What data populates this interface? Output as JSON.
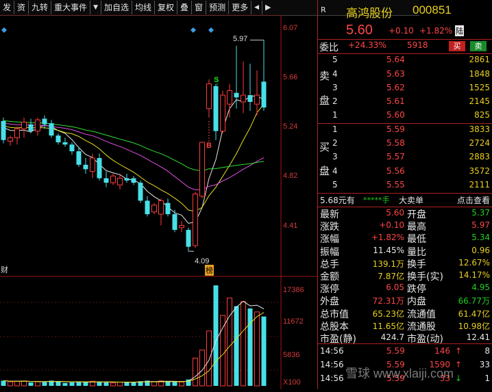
{
  "toolbar": {
    "items": [
      "发",
      "资",
      "九转",
      "重大事件",
      "▼",
      "加自选",
      "均线",
      "复权",
      "叠",
      "窗",
      "预测",
      "更多",
      "◀",
      "▶"
    ]
  },
  "chart": {
    "price_axis": [
      "6.07",
      "5.66",
      "5.24",
      "4.82",
      "4.41"
    ],
    "volume_axis": [
      "17386",
      "11672",
      "5836",
      "X100"
    ],
    "high_label": "5.97",
    "low_label": "4.09",
    "mark_s": "S",
    "mark_b": "B",
    "left_tag": "财",
    "bottom_tag": "榜"
  },
  "chart_data": {
    "type": "candlestick",
    "ohlc": [
      [
        5.25,
        5.28,
        5.05,
        5.08
      ],
      [
        5.07,
        5.12,
        5.03,
        5.1
      ],
      [
        5.1,
        5.2,
        5.04,
        5.18
      ],
      [
        5.18,
        5.28,
        5.1,
        5.24
      ],
      [
        5.22,
        5.27,
        5.14,
        5.16
      ],
      [
        5.16,
        5.28,
        5.12,
        5.26
      ],
      [
        5.27,
        5.3,
        5.18,
        5.22
      ],
      [
        5.23,
        5.26,
        5.1,
        5.12
      ],
      [
        5.12,
        5.14,
        5.04,
        5.06
      ],
      [
        5.06,
        5.1,
        5.02,
        5.04
      ],
      [
        5.04,
        5.06,
        4.95,
        4.98
      ],
      [
        4.98,
        5.02,
        4.84,
        4.86
      ],
      [
        4.86,
        4.92,
        4.78,
        4.82
      ],
      [
        4.8,
        4.96,
        4.74,
        4.92
      ],
      [
        4.92,
        4.96,
        4.72,
        4.74
      ],
      [
        4.74,
        4.8,
        4.66,
        4.7
      ],
      [
        4.7,
        4.78,
        4.68,
        4.76
      ],
      [
        4.68,
        4.78,
        4.64,
        4.74
      ],
      [
        4.74,
        4.78,
        4.7,
        4.72
      ],
      [
        4.74,
        4.76,
        4.68,
        4.7
      ],
      [
        4.7,
        4.72,
        4.52,
        4.54
      ],
      [
        4.54,
        4.58,
        4.4,
        4.42
      ],
      [
        4.44,
        4.52,
        4.42,
        4.5
      ],
      [
        4.42,
        4.56,
        4.32,
        4.54
      ],
      [
        4.52,
        4.56,
        4.4,
        4.42
      ],
      [
        4.42,
        4.46,
        4.26,
        4.28
      ],
      [
        4.3,
        4.36,
        4.26,
        4.32
      ],
      [
        4.28,
        4.3,
        4.09,
        4.13
      ],
      [
        4.14,
        4.62,
        4.12,
        4.6
      ],
      [
        4.58,
        5.06,
        4.56,
        5.06
      ],
      [
        5.36,
        5.62,
        5.28,
        5.58
      ],
      [
        5.56,
        5.58,
        5.08,
        5.16
      ],
      [
        5.16,
        5.52,
        5.14,
        5.48
      ],
      [
        5.4,
        5.58,
        5.28,
        5.52
      ],
      [
        5.5,
        5.92,
        5.36,
        5.46
      ],
      [
        5.42,
        5.78,
        5.32,
        5.48
      ],
      [
        5.48,
        5.76,
        5.34,
        5.42
      ],
      [
        5.4,
        5.7,
        5.3,
        5.48
      ],
      [
        5.6,
        5.97,
        5.34,
        5.37
      ]
    ],
    "volume": [
      900,
      700,
      800,
      850,
      600,
      700,
      650,
      900,
      800,
      500,
      600,
      700,
      650,
      800,
      700,
      600,
      500,
      650,
      700,
      600,
      800,
      900,
      700,
      850,
      750,
      700,
      650,
      1100,
      4800,
      6200,
      9500,
      17386,
      12200,
      15200,
      13800,
      14600,
      13400,
      12800,
      12000
    ],
    "ylim": [
      4.0,
      6.12
    ],
    "vol_ylim": [
      0,
      18000
    ]
  },
  "quote": {
    "code_label": "R",
    "name": "高鸿股份",
    "code": "000851",
    "price": "5.60",
    "change": "+0.10",
    "change_pct": "+1.82%",
    "tag": "陆",
    "weibi_label": "委比",
    "weibi_value": "+24.33%",
    "weicha_value": "5918",
    "buy_btn": "买",
    "sell_btn": "卖"
  },
  "sell_side": {
    "label_top": "卖",
    "label_bottom": "盘",
    "rows": [
      {
        "level": "5",
        "price": "5.64",
        "vol": "2861"
      },
      {
        "level": "4",
        "price": "5.63",
        "vol": "1848"
      },
      {
        "level": "3",
        "price": "5.62",
        "vol": "1525"
      },
      {
        "level": "2",
        "price": "5.61",
        "vol": "2145"
      },
      {
        "level": "1",
        "price": "5.60",
        "vol": "825"
      }
    ]
  },
  "buy_side": {
    "label_top": "买",
    "label_bottom": "盘",
    "rows": [
      {
        "level": "1",
        "price": "5.59",
        "vol": "3833"
      },
      {
        "level": "2",
        "price": "5.58",
        "vol": "2724"
      },
      {
        "level": "3",
        "price": "5.57",
        "vol": "2883"
      },
      {
        "level": "4",
        "price": "5.56",
        "vol": "3572"
      },
      {
        "level": "5",
        "price": "5.55",
        "vol": "2111"
      }
    ]
  },
  "level2": {
    "left": "5.68元有",
    "mid": "*****手",
    "mid2": "大卖单",
    "right": "点击查看"
  },
  "stats": [
    {
      "k1": "最新",
      "v1": "5.60",
      "k2": "开盘",
      "v2": "5.37"
    },
    {
      "k1": "涨跌",
      "v1": "+0.10",
      "k2": "最高",
      "v2": "5.97"
    },
    {
      "k1": "涨幅",
      "v1": "+1.82%",
      "k2": "最低",
      "v2": "5.34"
    },
    {
      "k1": "振幅",
      "v1": "11.45%",
      "k2": "量比",
      "v2": "0.96"
    },
    {
      "k1": "总手",
      "v1": "139.1万",
      "k2": "换手",
      "v2": "12.67%"
    },
    {
      "k1": "金额",
      "v1": "7.87亿",
      "k2": "换手(实)",
      "v2": "14.17%"
    },
    {
      "k1": "涨停",
      "v1": "6.05",
      "k2": "跌停",
      "v2": "4.95"
    },
    {
      "k1": "外盘",
      "v1": "72.31万",
      "k2": "内盘",
      "v2": "66.77万"
    },
    {
      "k1": "总市值",
      "v1": "65.23亿",
      "k2": "流通值",
      "v2": "61.47亿"
    },
    {
      "k1": "总股本",
      "v1": "11.65亿",
      "k2": "流通股",
      "v2": "10.98亿"
    },
    {
      "k1": "市盈(静)",
      "v1": "424.7",
      "k2": "市盈(动)",
      "v2": "12.41"
    }
  ],
  "ticks": [
    {
      "time": "14:56",
      "price": "5.59",
      "vol": "146",
      "arrow": "↑",
      "n": "8"
    },
    {
      "time": "14:56",
      "price": "5.59",
      "vol": "1590",
      "arrow": "↑",
      "n": "33"
    },
    {
      "time": "14:56",
      "price": "5.59",
      "vol": "33",
      "arrow": "↓",
      "n": "1"
    }
  ],
  "watermark": "雪球 www.xlaiji.com"
}
